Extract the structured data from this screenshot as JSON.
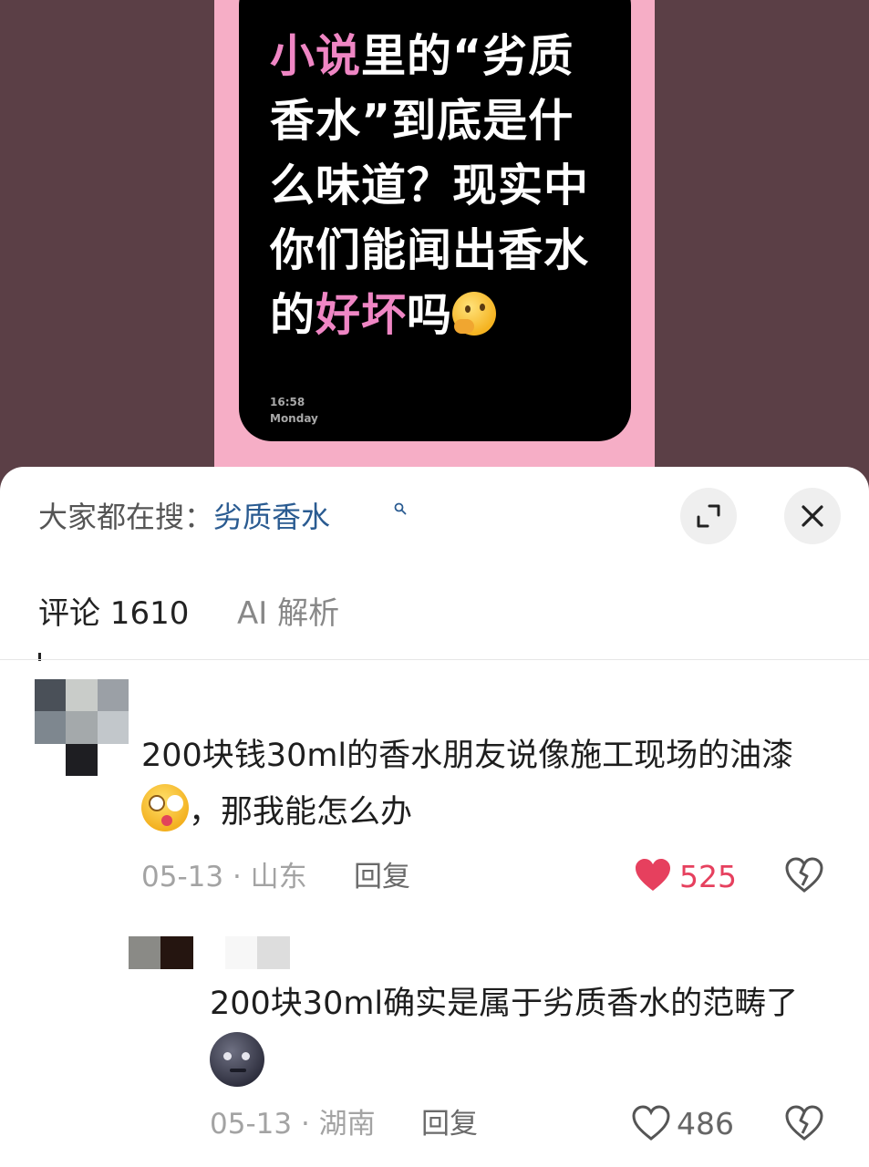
{
  "video_card": {
    "headline": {
      "line1_pink": "小说",
      "line1_rest": "里的“劣质",
      "line2": "香水”到底是什",
      "line3": "么味道？现实中",
      "line4": "你们能闻出香水",
      "line5_pre": "的",
      "line5_pink": "好坏",
      "line5_post": "吗"
    },
    "time": "16:58",
    "day": "Monday"
  },
  "search_bar": {
    "prefix": "大家都在搜：",
    "query": "劣质香水"
  },
  "tabs": [
    {
      "label": "评论 1610"
    },
    {
      "label": "AI 解析"
    }
  ],
  "comments": [
    {
      "text_before_emoji": "200块钱30ml的香水朋友说像施工现场的油漆",
      "text_after_emoji": "，那我能怎么办",
      "date": "05-13",
      "location": "山东",
      "reply_label": "回复",
      "likes": "525",
      "liked": true
    },
    {
      "text_before_emoji": "200块30ml确实是属于劣质香水的范畴了",
      "text_after_emoji": "",
      "date": "05-13",
      "location": "湖南",
      "reply_label": "回复",
      "likes": "486",
      "liked": false
    }
  ],
  "icons": {
    "expand": "expand-icon",
    "close": "close-icon",
    "search": "search-icon",
    "heart": "heart-icon",
    "dislike": "broken-heart-icon"
  },
  "colors": {
    "accent_pink": "#ef86c4",
    "like_red": "#e6405e",
    "link_blue": "#2a5b91"
  }
}
